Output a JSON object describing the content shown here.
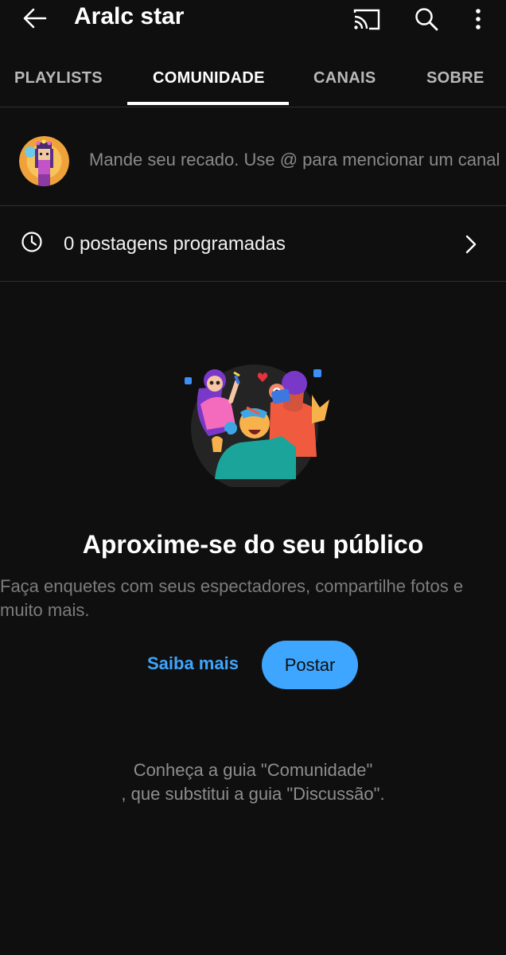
{
  "header": {
    "title": "Aralc star",
    "back_icon": "arrow-left-icon",
    "cast_icon": "cast-icon",
    "search_icon": "search-icon",
    "more_icon": "more-vertical-icon"
  },
  "tabs": [
    {
      "label": "PLAYLISTS",
      "active": false
    },
    {
      "label": "COMUNIDADE",
      "active": true
    },
    {
      "label": "CANAIS",
      "active": false
    },
    {
      "label": "SOBRE",
      "active": false
    }
  ],
  "compose": {
    "placeholder": "Mande seu recado. Use @ para mencionar um canal"
  },
  "scheduled": {
    "label": "0 postagens programadas",
    "icon": "clock-icon",
    "chevron": "chevron-right-icon"
  },
  "empty_state": {
    "heading": "Aproxime-se do seu público",
    "description": "Faça enquetes com seus espectadores, compartilhe fotos e muito mais.",
    "learn_more": "Saiba mais",
    "post_button": "Postar"
  },
  "footer": {
    "line1": "Conheça a guia \"Comunidade\"",
    "line2": ", que substitui a guia \"Discussão\"."
  },
  "colors": {
    "background": "#0f0f0f",
    "accent": "#3ea6ff",
    "muted_text": "#7c7c7c"
  }
}
